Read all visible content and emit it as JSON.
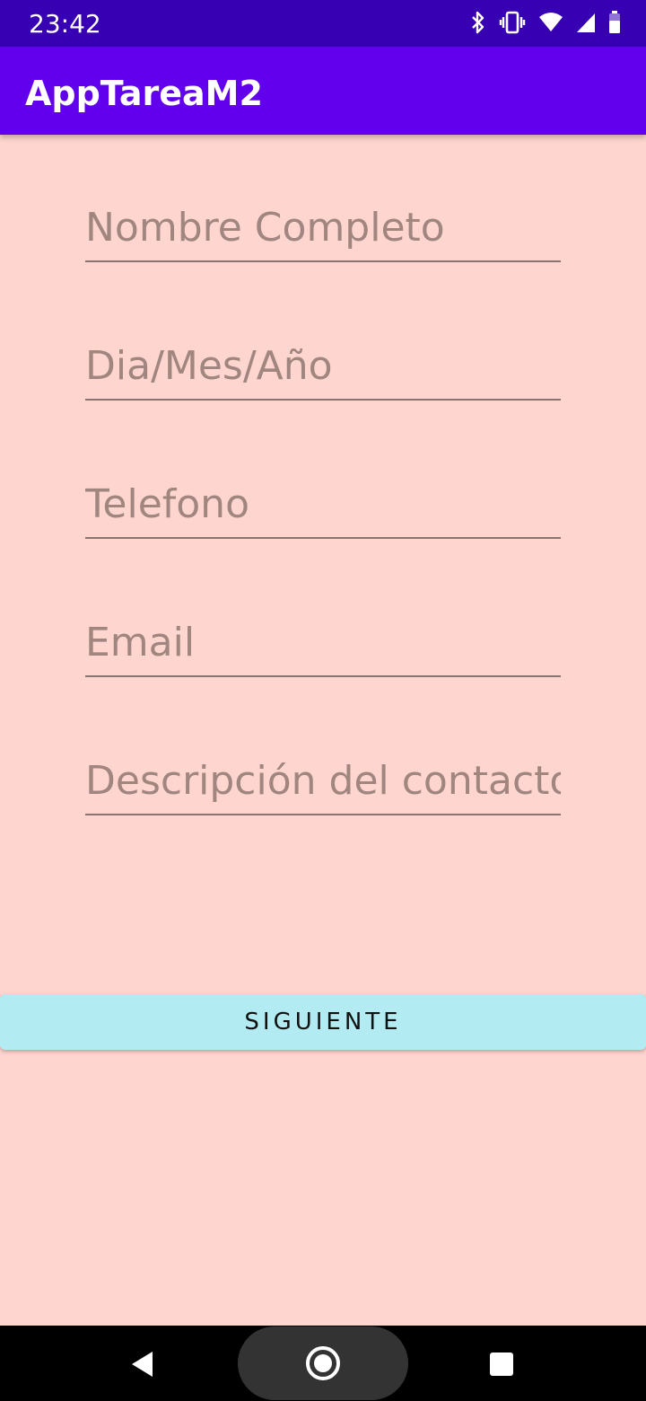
{
  "status_bar": {
    "time": "23:42",
    "icons": [
      "bluetooth-icon",
      "vibrate-icon",
      "wifi-icon",
      "signal-icon",
      "battery-icon"
    ]
  },
  "app_bar": {
    "title": "AppTareaM2"
  },
  "form": {
    "fields": [
      {
        "placeholder": "Nombre Completo",
        "value": ""
      },
      {
        "placeholder": "Dia/Mes/Año",
        "value": ""
      },
      {
        "placeholder": "Telefono",
        "value": ""
      },
      {
        "placeholder": "Email",
        "value": ""
      },
      {
        "placeholder": "Descripción del contacto",
        "value": ""
      }
    ],
    "submit_label": "SIGUIENTE"
  },
  "nav_bar": {
    "buttons": [
      "back-icon",
      "home-icon",
      "recents-icon"
    ]
  },
  "colors": {
    "status_bar": "#3700B3",
    "app_bar": "#6200EE",
    "background": "#FFD5CF",
    "button": "#B2EBF2",
    "placeholder": "#A0867F"
  }
}
